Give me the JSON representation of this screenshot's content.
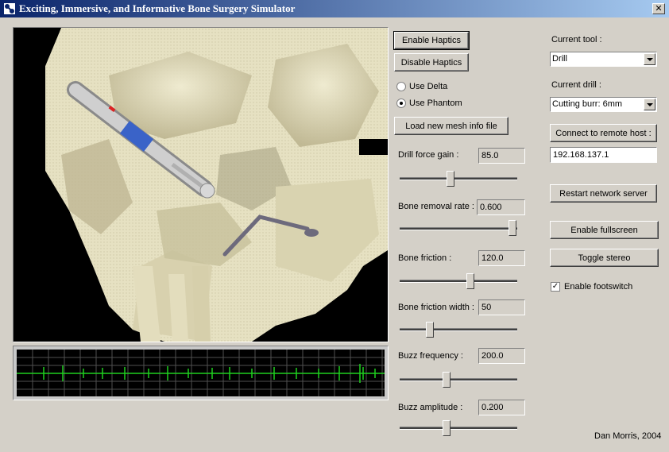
{
  "window": {
    "title": "Exciting, Immersive, and Informative Bone Surgery Simulator",
    "close_glyph": "✕"
  },
  "buttons": {
    "enable_haptics": "Enable Haptics",
    "disable_haptics": "Disable Haptics",
    "load_mesh": "Load new mesh info file",
    "connect_remote": "Connect to remote host :",
    "restart_server": "Restart network server",
    "enable_fullscreen": "Enable fullscreen",
    "toggle_stereo": "Toggle stereo"
  },
  "device": {
    "options": [
      {
        "label": "Use Delta",
        "selected": false
      },
      {
        "label": "Use Phantom",
        "selected": true
      }
    ]
  },
  "sliders": [
    {
      "label": "Drill force gain :",
      "value": "85.0",
      "position": 0.45
    },
    {
      "label": "Bone removal rate :",
      "value": "0.600",
      "position": 1.0
    },
    {
      "label": "Bone friction :",
      "value": "120.0",
      "position": 0.6
    },
    {
      "label": "Bone friction width :",
      "value": "50",
      "position": 0.25
    },
    {
      "label": "Buzz frequency :",
      "value": "200.0",
      "position": 0.4
    },
    {
      "label": "Buzz amplitude :",
      "value": "0.200",
      "position": 0.4
    }
  ],
  "tool": {
    "label": "Current tool :",
    "value": "Drill"
  },
  "drill": {
    "label": "Current drill :",
    "value": "Cutting burr: 6mm"
  },
  "remote_host": {
    "value": "192.168.137.1"
  },
  "footswitch": {
    "label": "Enable footswitch",
    "checked": true,
    "check_glyph": "✓"
  },
  "credit": "Dan Morris, 2004"
}
